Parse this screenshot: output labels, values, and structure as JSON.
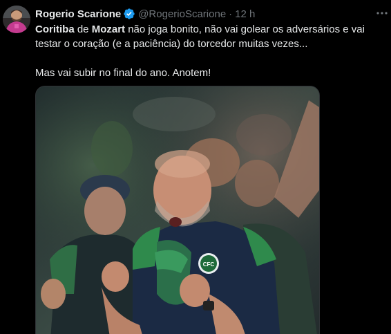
{
  "author": {
    "display_name": "Rogerio Scarione",
    "handle": "@RogerioScarione",
    "separator": "·",
    "time": "12 h",
    "verified_color": "#1d9bf0"
  },
  "tweet": {
    "line1_bold1": "Coritiba",
    "line1_mid": " de ",
    "line1_bold2": "Mozart",
    "line1_rest": " não joga bonito, não vai golear os adversários e vai testar o coração (e a paciência) do torcedor muitas vezes...",
    "line2": "Mas vai subir no final do ano. Anotem!"
  },
  "media": {
    "crest_text": "CFC",
    "kind": "photo"
  },
  "colors": {
    "background": "#000000",
    "text": "#e7e9ea",
    "muted": "#71767b",
    "accent": "#1d9bf0"
  },
  "icons": {
    "verified": "verified-badge-icon",
    "more": "more-options-icon"
  }
}
